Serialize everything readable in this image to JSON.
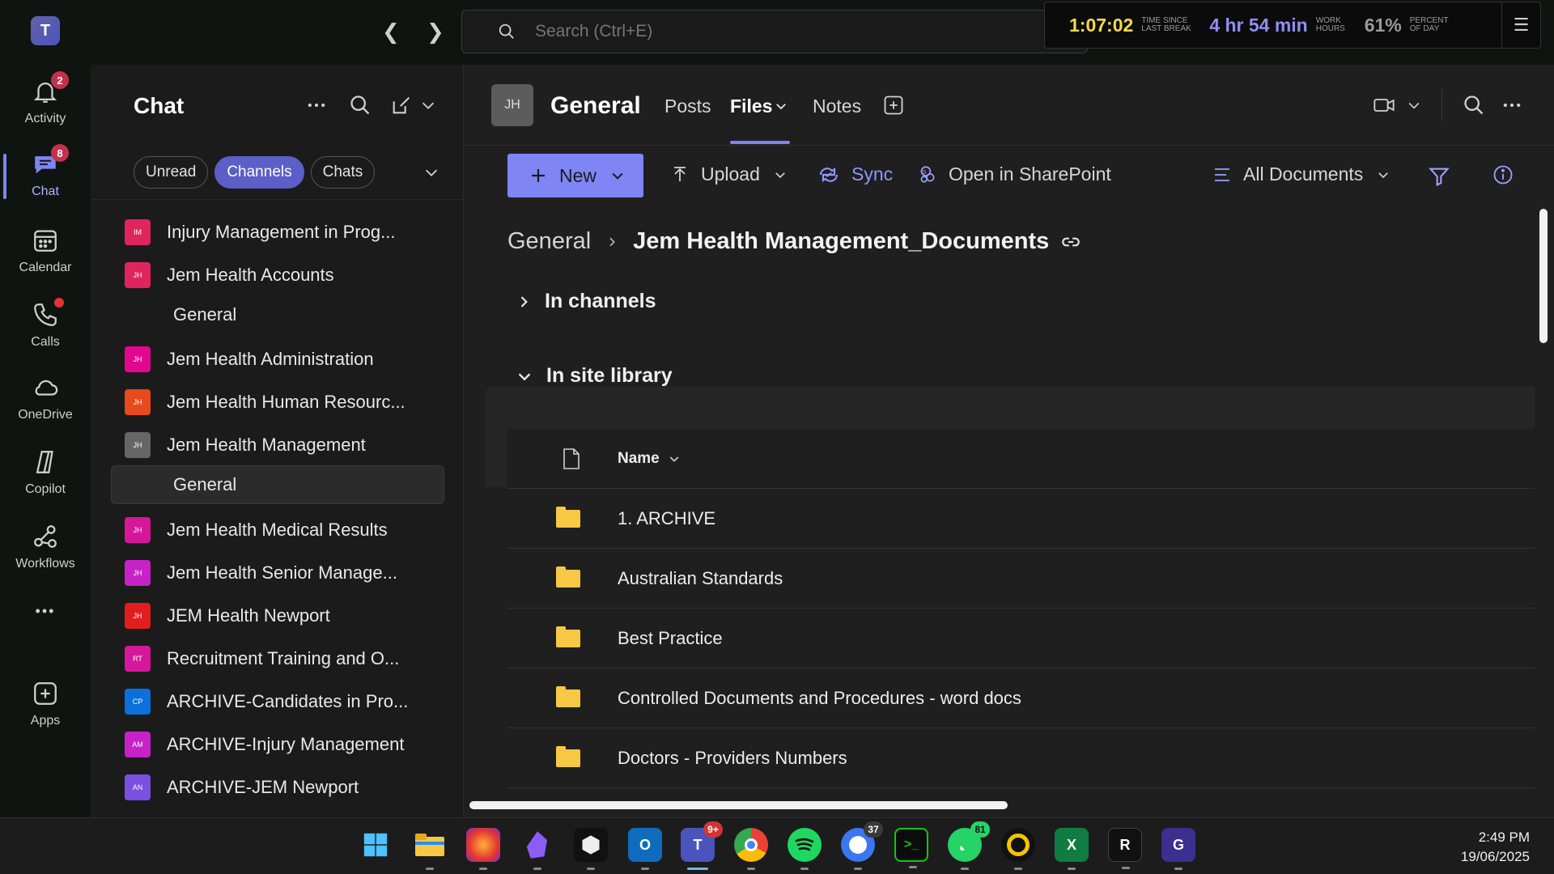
{
  "topbar": {
    "search_placeholder": "Search (Ctrl+E)",
    "tracker": {
      "time_since_break": "1:07:02",
      "time_since_break_label": "TIME SINCE LAST BREAK",
      "work_hours": "4 hr 54 min",
      "work_hours_label": "WORK HOURS",
      "percent_day": "61%",
      "percent_day_label": "PERCENT OF DAY"
    }
  },
  "rail": {
    "items": [
      {
        "label": "Activity",
        "badge": "2"
      },
      {
        "label": "Chat",
        "badge": "8"
      },
      {
        "label": "Calendar"
      },
      {
        "label": "Calls"
      },
      {
        "label": "OneDrive"
      },
      {
        "label": "Copilot"
      },
      {
        "label": "Workflows"
      },
      {
        "label": "Apps"
      }
    ],
    "more": "•••"
  },
  "chat": {
    "title": "Chat",
    "filters": [
      "Unread",
      "Channels",
      "Chats"
    ],
    "teams": [
      {
        "initials": "IM",
        "name": "Injury Management in Prog...",
        "color": "#e0245e"
      },
      {
        "initials": "JH",
        "name": "Jem Health Accounts",
        "color": "#e0245e"
      },
      {
        "name": "General",
        "channel": true
      },
      {
        "initials": "JH",
        "name": "Jem Health Administration",
        "color": "#e3068f"
      },
      {
        "initials": "JH",
        "name": "Jem Health Human Resourc...",
        "color": "#e8491d"
      },
      {
        "initials": "JH",
        "name": "Jem Health Management",
        "color": "#666666"
      },
      {
        "name": "General",
        "channel": true,
        "selected": true
      },
      {
        "initials": "JH",
        "name": "Jem Health Medical Results",
        "color": "#d6169b"
      },
      {
        "initials": "JH",
        "name": "Jem Health Senior Manage...",
        "color": "#c622c7"
      },
      {
        "initials": "JH",
        "name": "JEM Health Newport",
        "color": "#e01e1e"
      },
      {
        "initials": "RT",
        "name": "Recruitment Training and O...",
        "color": "#d6169b"
      },
      {
        "initials": "CP",
        "name": "ARCHIVE-Candidates in Pro...",
        "color": "#0b6fdc"
      },
      {
        "initials": "AM",
        "name": "ARCHIVE-Injury Management",
        "color": "#c622c7"
      },
      {
        "initials": "AN",
        "name": "ARCHIVE-JEM Newport",
        "color": "#7b4fe0"
      }
    ]
  },
  "main": {
    "channel_initials": "JH",
    "channel_name": "General",
    "tabs": [
      "Posts",
      "Files",
      "Notes"
    ],
    "toolbar": {
      "new": "New",
      "upload": "Upload",
      "sync": "Sync",
      "open_sharepoint": "Open in SharePoint",
      "view": "All Documents"
    },
    "breadcrumb": {
      "root": "General",
      "current": "Jem Health Management_Documents"
    },
    "sections": {
      "channels": "In channels",
      "site_library": "In site library"
    },
    "table": {
      "name_header": "Name",
      "rows": [
        "1. ARCHIVE",
        "Australian Standards",
        "Best Practice",
        "Controlled Documents and Procedures - word docs",
        "Doctors - Providers Numbers"
      ]
    }
  },
  "taskbar": {
    "badges": {
      "teams": "9+",
      "signal": "37",
      "whatsapp": "81"
    },
    "time": "2:49 PM",
    "date": "19/06/2025"
  },
  "colors": {
    "accent": "#7f85f5",
    "folder": "#f7c844",
    "badge": "#c4314b"
  }
}
